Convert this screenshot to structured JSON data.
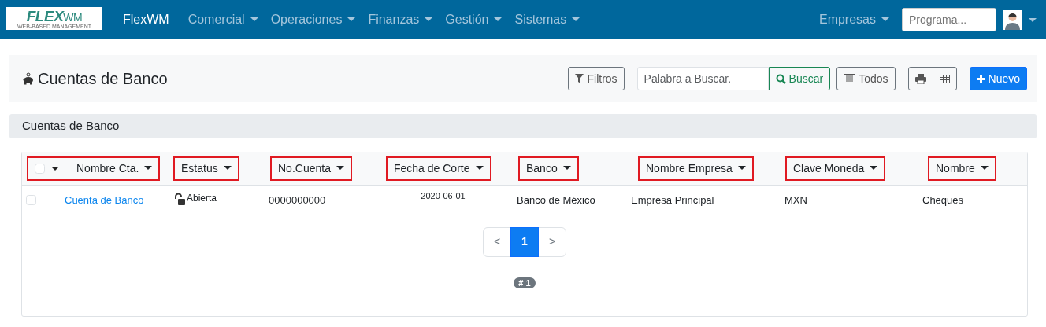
{
  "navbar": {
    "logo": {
      "word": "FLEX",
      "suffix": "WM",
      "tagline": "WEB-BASED MANAGEMENT"
    },
    "brand": "FlexWM",
    "menus": [
      {
        "label": "Comercial",
        "dropdown": true
      },
      {
        "label": "Operaciones",
        "dropdown": true
      },
      {
        "label": "Finanzas",
        "dropdown": true
      },
      {
        "label": "Gestión",
        "dropdown": true
      },
      {
        "label": "Sistemas",
        "dropdown": true
      }
    ],
    "right_menu": {
      "label": "Empresas",
      "dropdown": true
    },
    "program_field": {
      "placeholder": "Programa..."
    },
    "user_menu": {
      "dropdown": true
    }
  },
  "page_header": {
    "title": "Cuentas de Banco",
    "filters_button": "Filtros",
    "search": {
      "placeholder": "Palabra a Buscar."
    },
    "search_button": "Buscar",
    "all_button": "Todos",
    "new_button": "Nuevo"
  },
  "section": {
    "title": "Cuentas de Banco"
  },
  "table": {
    "select_all": {
      "checked": false
    },
    "columns": [
      {
        "label": "Nombre Cta.",
        "highlighted": true
      },
      {
        "label": "Estatus",
        "highlighted": true
      },
      {
        "label": "No.Cuenta",
        "highlighted": true
      },
      {
        "label": "Fecha de Corte",
        "highlighted": true
      },
      {
        "label": "Banco",
        "highlighted": true
      },
      {
        "label": "Nombre Empresa",
        "highlighted": true
      },
      {
        "label": "Clave Moneda",
        "highlighted": true
      },
      {
        "label": "Nombre",
        "highlighted": true
      }
    ],
    "rows": [
      {
        "checked": false,
        "cells": [
          "Cuenta de Banco",
          "Abierta",
          "0000000000",
          "2020-06-01",
          "Banco de México",
          "Empresa Principal",
          "MXN",
          "Cheques"
        ]
      }
    ]
  },
  "pagination": {
    "prev": "<",
    "pages": [
      {
        "label": "1",
        "selected": true
      }
    ],
    "next": ">"
  },
  "record_count": "# 1"
}
